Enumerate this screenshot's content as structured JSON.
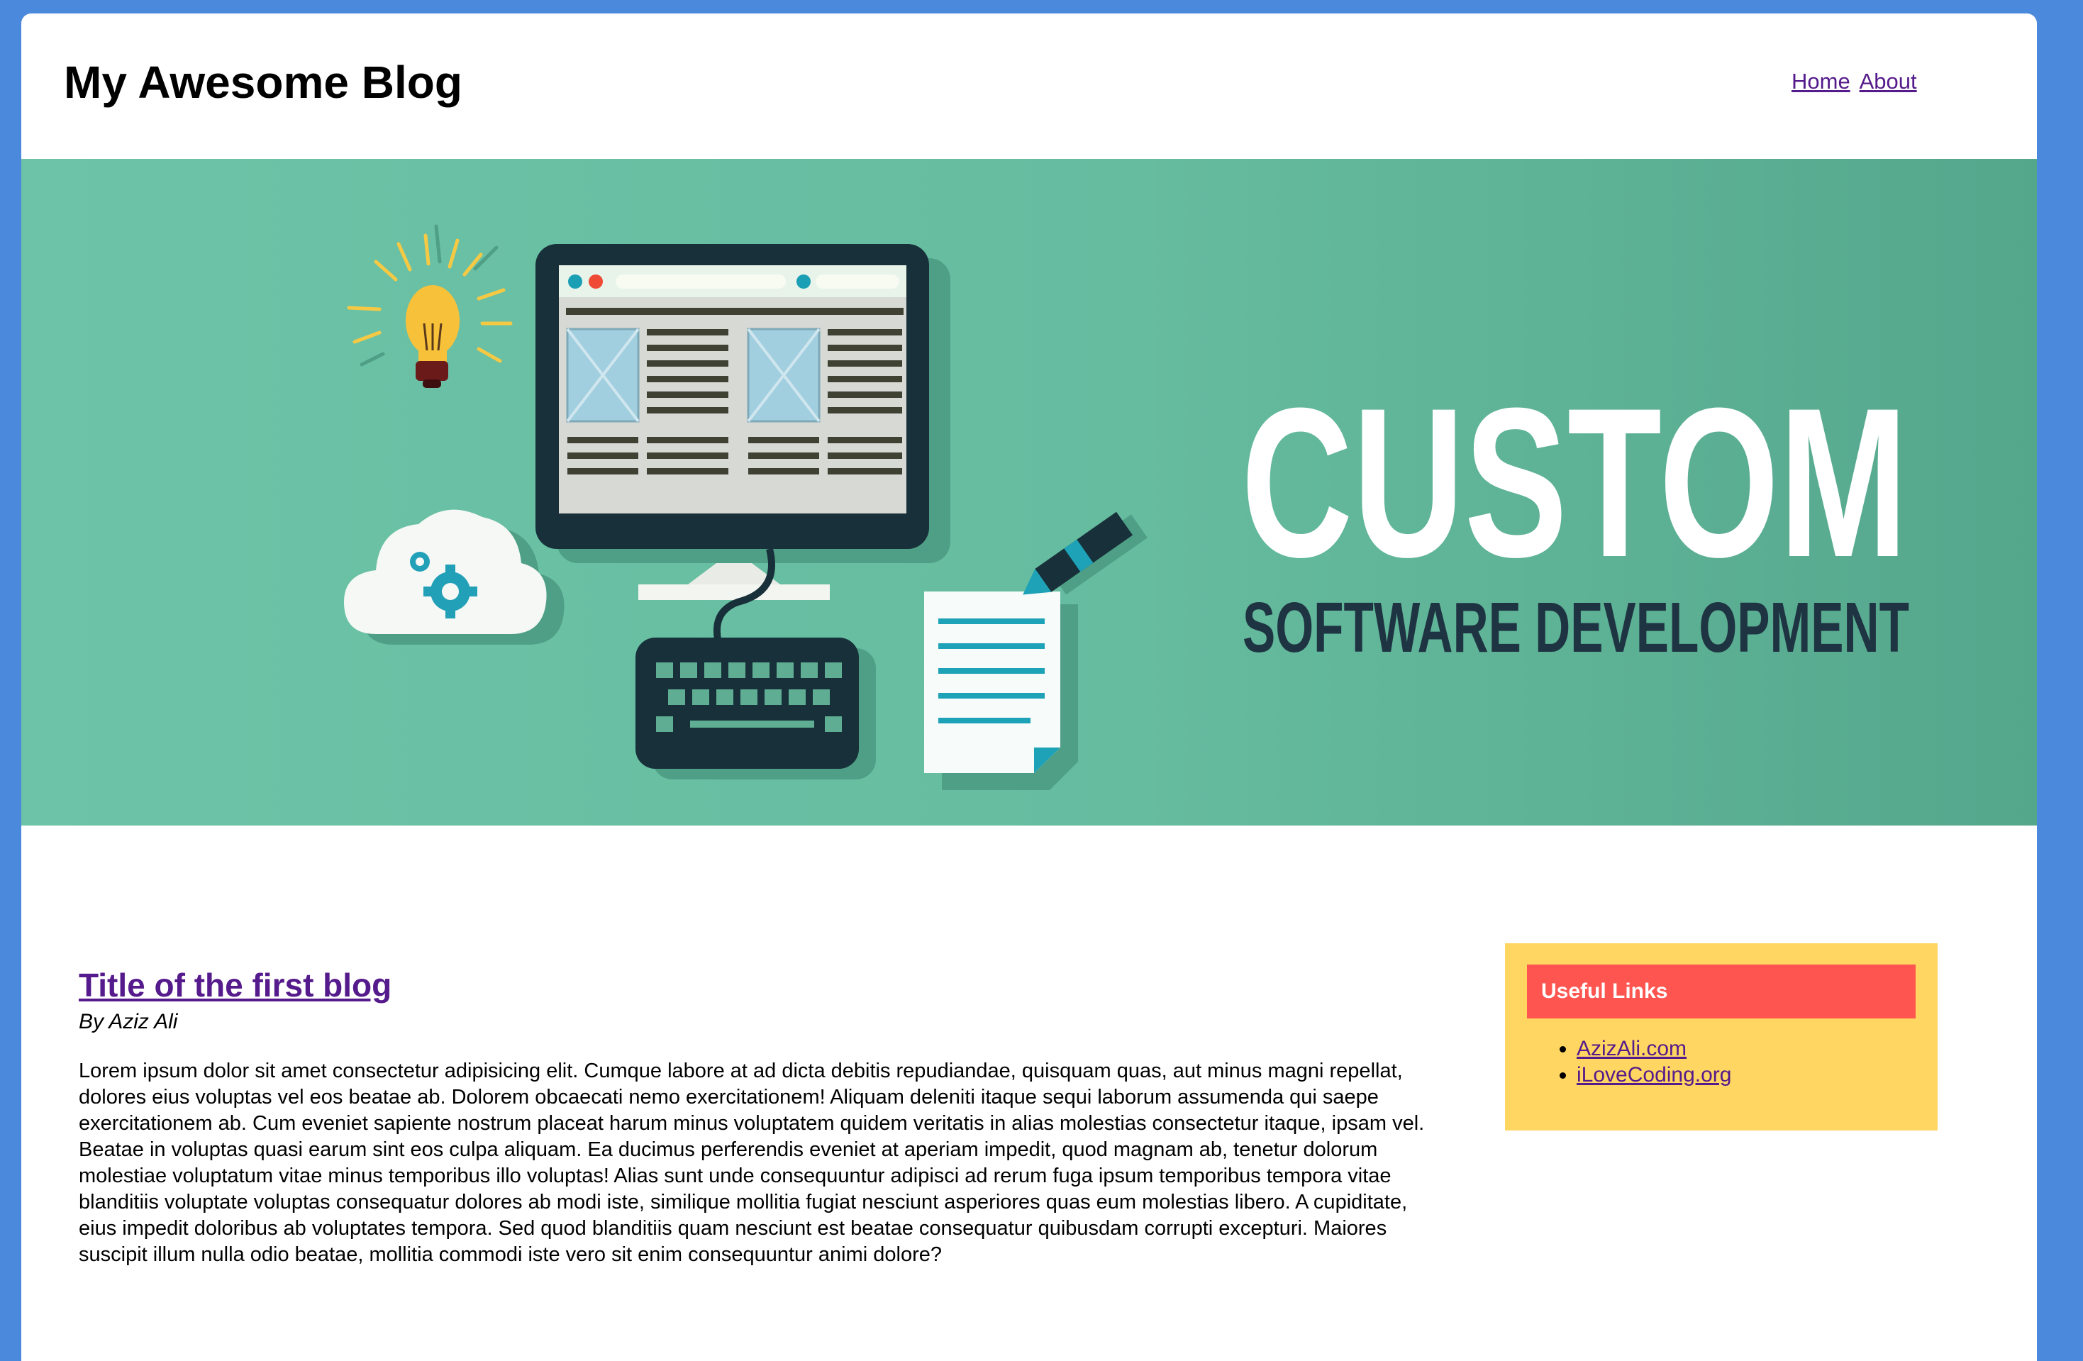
{
  "header": {
    "site_title": "My Awesome Blog",
    "nav": [
      {
        "label": "Home"
      },
      {
        "label": "About"
      }
    ]
  },
  "hero": {
    "headline": "CUSTOM",
    "subheadline": "SOFTWARE DEVELOPMENT",
    "icons": [
      "lightbulb-icon",
      "cloud-gear-icon",
      "monitor-icon",
      "keyboard-icon",
      "document-pen-icon"
    ]
  },
  "post": {
    "title": "Title of the first blog",
    "author": "By Aziz Ali",
    "body": "Lorem ipsum dolor sit amet consectetur adipisicing elit. Cumque labore at ad dicta debitis repudiandae, quisquam quas, aut minus magni repellat, dolores eius voluptas vel eos beatae ab. Dolorem obcaecati nemo exercitationem! Aliquam deleniti itaque sequi laborum assumenda qui saepe exercitationem ab. Cum eveniet sapiente nostrum placeat harum minus voluptatem quidem veritatis in alias molestias consectetur itaque, ipsam vel. Beatae in voluptas quasi earum sint eos culpa aliquam. Ea ducimus perferendis eveniet at aperiam impedit, quod magnam ab, tenetur dolorum molestiae voluptatum vitae minus temporibus illo voluptas! Alias sunt unde consequuntur adipisci ad rerum fuga ipsum temporibus tempora vitae blanditiis voluptate voluptas consequatur dolores ab modi iste, similique mollitia fugiat nesciunt asperiores quas eum molestias libero. A cupiditate, eius impedit doloribus ab voluptates tempora. Sed quod blanditiis quam nesciunt est beatae consequatur quibusdam corrupti excepturi. Maiores suscipit illum nulla odio beatae, mollitia commodi iste vero sit enim consequuntur animi dolore?"
  },
  "sidebar": {
    "heading": "Useful Links",
    "links": [
      {
        "label": "AzizAli.com"
      },
      {
        "label": "iLoveCoding.org"
      }
    ]
  },
  "colors": {
    "background": "#4a89dc",
    "hero_green": "#66bc9f",
    "sidebar_bg": "#ffd662",
    "sidebar_head": "#ff5551",
    "link": "#551a8b"
  }
}
